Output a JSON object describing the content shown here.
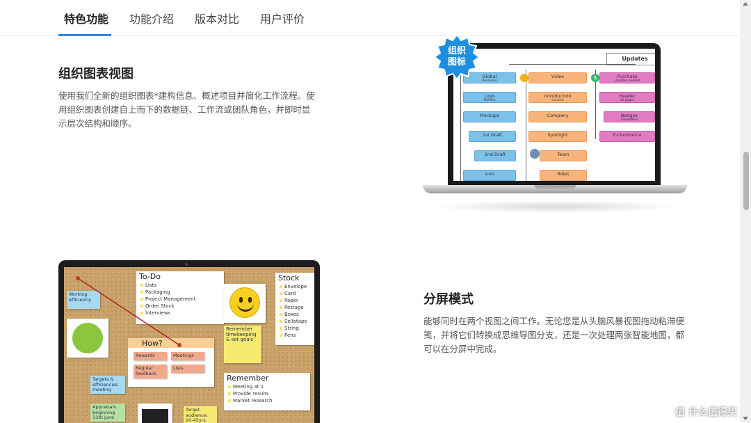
{
  "tabs": [
    {
      "label": "特色功能",
      "active": true
    },
    {
      "label": "功能介绍",
      "active": false
    },
    {
      "label": "版本对比",
      "active": false
    },
    {
      "label": "用户评价",
      "active": false
    }
  ],
  "section1": {
    "title": "组织图表视图",
    "description": "使用我们全新的组织图表*建构信息、概述项目并简化工作流程。使用组织图表创建自上而下的数据链、工作流或团队角色，并即时显示层次结构和顺序。"
  },
  "section2": {
    "title": "分屏模式",
    "description": "能够同时在两个视图之间工作。无论您是从头脑风暴视图拖动粘滞便笺，并将它们转换成思维导图分支，还是一次处理两张智能地图，都可以在分屏中完成。"
  },
  "org_chart": {
    "badge": "组织\n图标",
    "updates": "Updates",
    "blue_nodes": [
      {
        "label": "Global",
        "sub": "Revisions"
      },
      {
        "label": "Logo",
        "sub": "Refresh"
      },
      {
        "label": "Mockups",
        "sub": ""
      },
      {
        "label": "1st Draft",
        "sub": ""
      },
      {
        "label": "2nd Draft",
        "sub": ""
      },
      {
        "label": "Icon",
        "sub": ""
      }
    ],
    "orange_nodes": [
      {
        "label": "Video",
        "sub": ""
      },
      {
        "label": "Introduction",
        "sub": "Concise"
      },
      {
        "label": "Company",
        "sub": ""
      },
      {
        "label": "Spotlight",
        "sub": ""
      },
      {
        "label": "Team",
        "sub": ""
      },
      {
        "label": "Roles",
        "sub": ""
      }
    ],
    "pink_nodes": [
      {
        "label": "Purchase",
        "sub": "Updates needed"
      },
      {
        "label": "Header",
        "sub": "All pages"
      },
      {
        "label": "Badges",
        "sub": "Salesoffers"
      },
      {
        "label": "E-commerce",
        "sub": ""
      }
    ]
  },
  "board": {
    "todo_title": "To-Do",
    "todo_items": [
      "Lists",
      "Packaging",
      "Project Management",
      "Order Stock",
      "Interviews"
    ],
    "stock_title": "Stock",
    "stock_items": [
      "Envelope",
      "Card",
      "Paper",
      "Postage",
      "Boxes",
      "Sellotape",
      "String",
      "Pens"
    ],
    "how_title": "How?",
    "how_notes": [
      "Rewards",
      "Meetings",
      "Regular feedback",
      "Lists"
    ],
    "remember_title": "Remember",
    "remember_items": [
      "Meeting at 1",
      "Provide results",
      "Market research"
    ],
    "notes": {
      "working": "Working efficiently",
      "remember_goals": "Remember timekeeping & set goals",
      "targets": "Targets & efficiencies meeting",
      "appraisals": "Appraisals beginning 12th June",
      "target_audience": "Target audience: 20-45yrs"
    }
  },
  "watermark": "值 什么值得买",
  "colors": {
    "accent": "#2f86e8"
  }
}
